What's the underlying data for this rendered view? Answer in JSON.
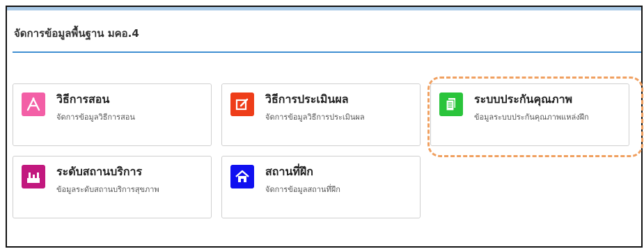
{
  "header": {
    "title": "จัดการข้อมูลพื้นฐาน มคอ.4"
  },
  "cards": [
    {
      "title": "วิธีการสอน",
      "desc": "จัดการข้อมูลวิธีการสอน",
      "icon": "app-store-icon",
      "color": "#f35fa6"
    },
    {
      "title": "วิธีการประเมินผล",
      "desc": "จัดการข้อมูลวิธีการประเมินผล",
      "icon": "edit-icon",
      "color": "#ee3d19"
    },
    {
      "title": "ระบบประกันคุณภาพ",
      "desc": "ข้อมูลระบบประกันคุณภาพแหล่งฝึก",
      "icon": "document-icon",
      "color": "#2ac43b"
    },
    {
      "title": "ระดับสถานบริการ",
      "desc": "ข้อมูลระดับสถานบริการสุขภาพ",
      "icon": "factory-icon",
      "color": "#c2187e"
    },
    {
      "title": "สถานที่ฝึก",
      "desc": "จัดการข้อมูลสถานที่ฝึก",
      "icon": "home-icon",
      "color": "#1010f0"
    }
  ]
}
